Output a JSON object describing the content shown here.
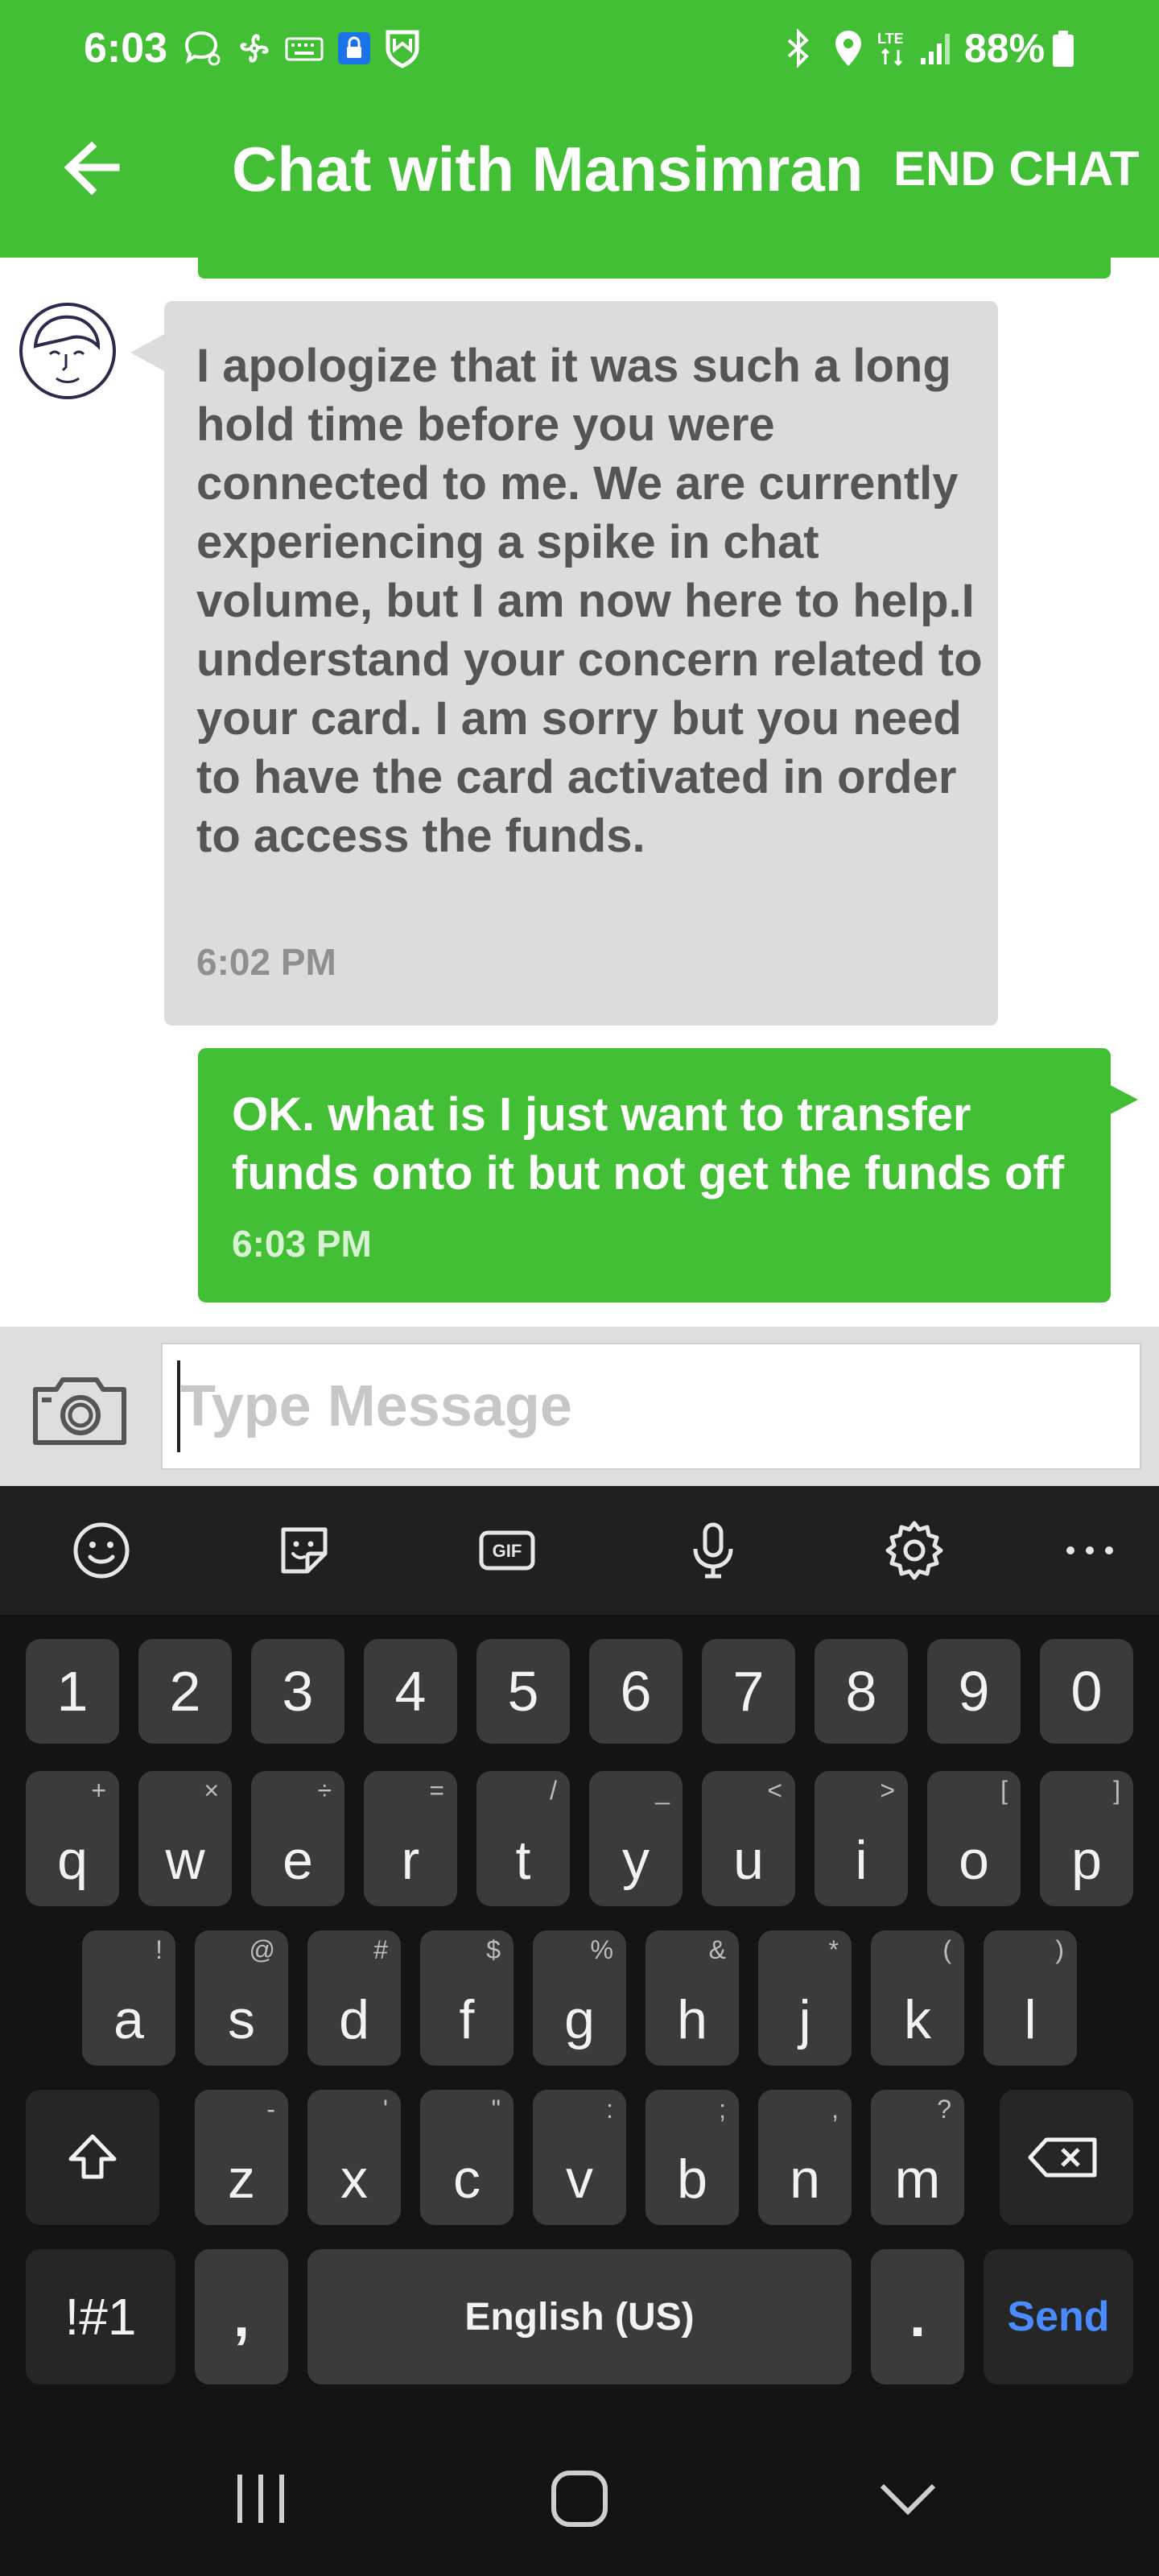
{
  "status_bar": {
    "time": "6:03",
    "battery": "88%",
    "network": "LTE",
    "left_icons": [
      "chat-bubble-icon",
      "pinwheel-icon",
      "keyboard-icon",
      "lock-icon",
      "shield-icon"
    ],
    "right_icons": [
      "bluetooth-icon",
      "location-icon",
      "lte-icon",
      "signal-icon",
      "battery-icon"
    ]
  },
  "header": {
    "title": "Chat with Mansimran",
    "end_chat_label": "END CHAT",
    "back_icon": "arrow-left-icon",
    "background_color": "#43bf36"
  },
  "messages": [
    {
      "sender": "agent",
      "text": "I apologize that it was such a long hold time before you were connected to me. We are currently experiencing a spike in chat volume, but I am now here to help.I understand your concern related to your card. I am sorry but you need to have the card activated in order to access the funds.",
      "time": "6:02 PM"
    },
    {
      "sender": "user",
      "text": "OK. what is I just want to transfer funds onto it but not get the funds off",
      "time": "6:03 PM"
    }
  ],
  "compose": {
    "placeholder": "Type Message",
    "camera_icon": "camera-icon"
  },
  "keyboard": {
    "toolbar": [
      "emoji-icon",
      "sticker-icon",
      "gif-icon",
      "microphone-icon",
      "settings-icon",
      "more-icon"
    ],
    "gif_label": "GIF",
    "number_row": [
      "1",
      "2",
      "3",
      "4",
      "5",
      "6",
      "7",
      "8",
      "9",
      "0"
    ],
    "row1": [
      {
        "key": "q",
        "hint": "+"
      },
      {
        "key": "w",
        "hint": "×"
      },
      {
        "key": "e",
        "hint": "÷"
      },
      {
        "key": "r",
        "hint": "="
      },
      {
        "key": "t",
        "hint": "/"
      },
      {
        "key": "y",
        "hint": "_"
      },
      {
        "key": "u",
        "hint": "<"
      },
      {
        "key": "i",
        "hint": ">"
      },
      {
        "key": "o",
        "hint": "["
      },
      {
        "key": "p",
        "hint": "]"
      }
    ],
    "row2": [
      {
        "key": "a",
        "hint": "!"
      },
      {
        "key": "s",
        "hint": "@"
      },
      {
        "key": "d",
        "hint": "#"
      },
      {
        "key": "f",
        "hint": "$"
      },
      {
        "key": "g",
        "hint": "%"
      },
      {
        "key": "h",
        "hint": "&"
      },
      {
        "key": "j",
        "hint": "*"
      },
      {
        "key": "k",
        "hint": "("
      },
      {
        "key": "l",
        "hint": ")"
      }
    ],
    "row3": [
      {
        "key": "z",
        "hint": "-"
      },
      {
        "key": "x",
        "hint": "'"
      },
      {
        "key": "c",
        "hint": "\""
      },
      {
        "key": "v",
        "hint": ":"
      },
      {
        "key": "b",
        "hint": ";"
      },
      {
        "key": "n",
        "hint": ","
      },
      {
        "key": "m",
        "hint": "?"
      }
    ],
    "symbols_label": "!#1",
    "comma_label": ",",
    "space_label": "English (US)",
    "period_label": ".",
    "send_label": "Send",
    "send_color": "#4a8cff"
  },
  "nav_bar": [
    "recent-apps-icon",
    "home-icon",
    "back-chevron-icon"
  ]
}
